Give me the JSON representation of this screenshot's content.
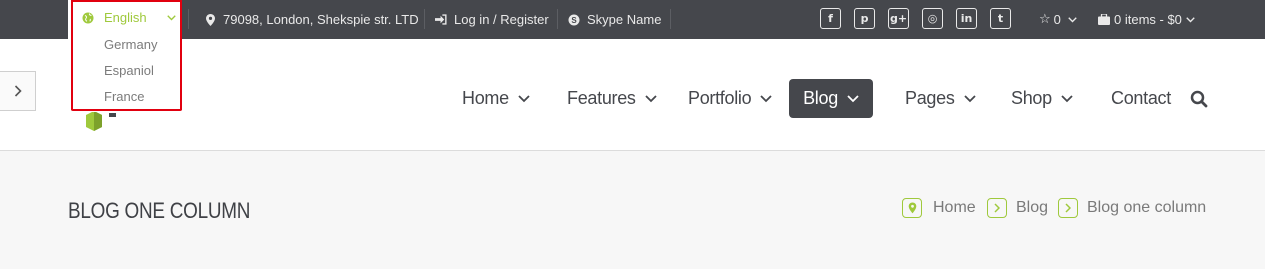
{
  "topbar": {
    "language": {
      "selected": "English",
      "options": [
        "Germany",
        "Espaniol",
        "France"
      ]
    },
    "address": "79098, London, Shekspie str. LTD",
    "auth": "Log in / Register",
    "skype": "Skype Name",
    "social": [
      {
        "icon": "facebook-icon",
        "glyph": "f"
      },
      {
        "icon": "pinterest-icon",
        "glyph": "p"
      },
      {
        "icon": "google-plus-icon",
        "glyph": "g+"
      },
      {
        "icon": "dribbble-icon",
        "glyph": "◎"
      },
      {
        "icon": "linkedin-icon",
        "glyph": "in"
      },
      {
        "icon": "twitter-icon",
        "glyph": "t"
      }
    ],
    "wishlist": "0",
    "cart": "0 items - $0"
  },
  "nav": {
    "items": [
      "Home",
      "Features",
      "Portfolio",
      "Blog",
      "Pages",
      "Shop",
      "Contact"
    ],
    "active": "Blog"
  },
  "page": {
    "title": "BLOG ONE COLUMN",
    "breadcrumb": [
      "Home",
      "Blog",
      "Blog one column"
    ]
  },
  "colors": {
    "topbar_bg": "#45474c",
    "accent": "#9fc93c",
    "highlight": "#e1000f"
  }
}
